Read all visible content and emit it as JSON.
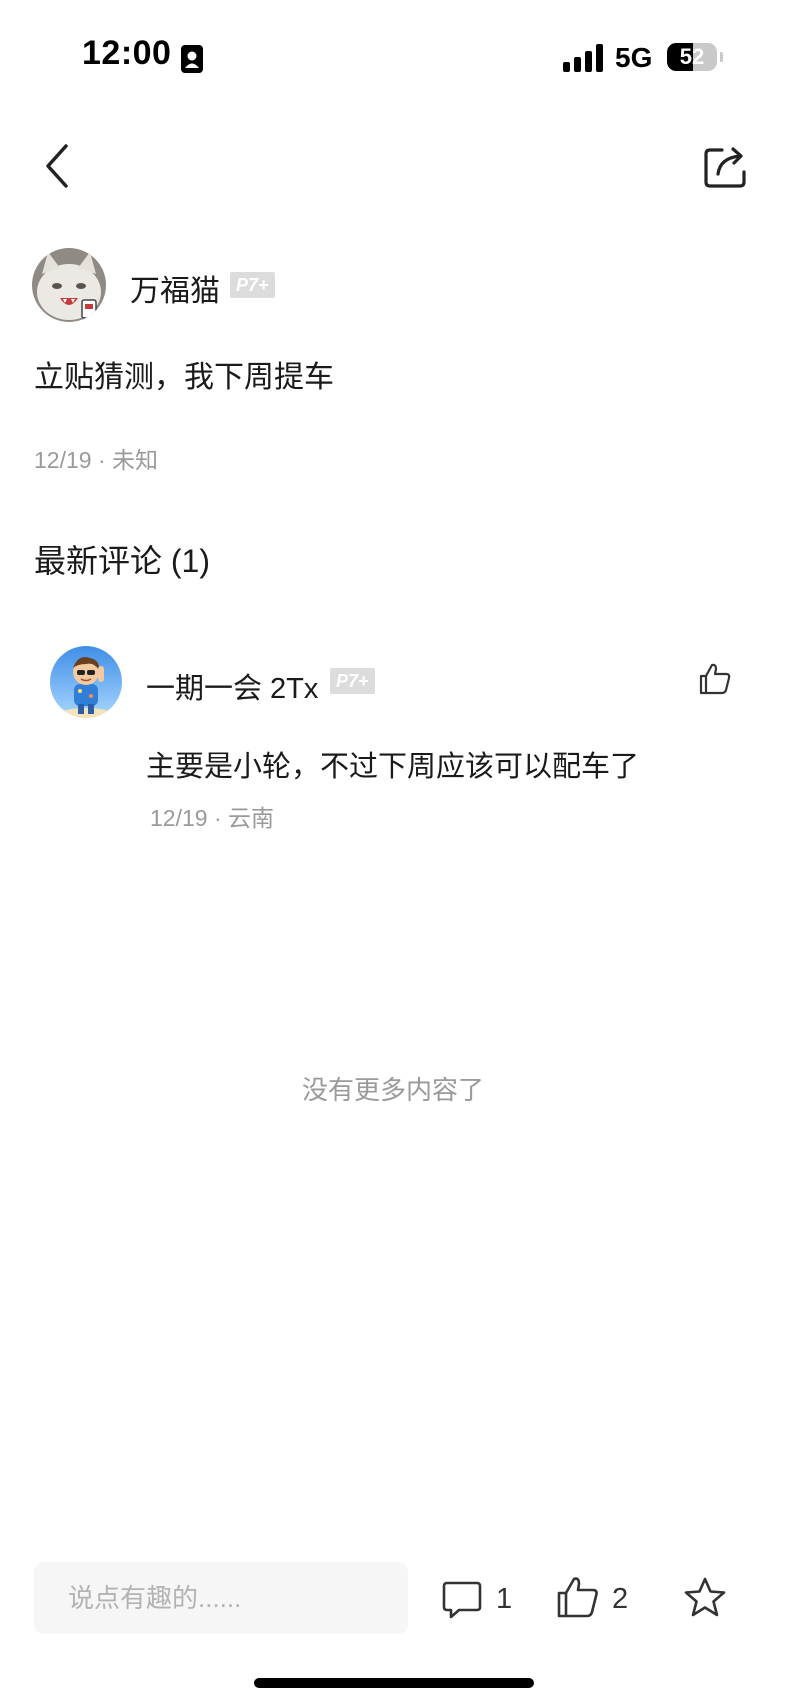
{
  "status_bar": {
    "time": "12:00",
    "network": "5G",
    "battery_level": "52",
    "battery_percent": 52,
    "signal_icon": "cellular-signal-icon",
    "id_icon": "contact-card-icon"
  },
  "nav": {
    "back_icon": "chevron-left-icon",
    "share_icon": "share-icon"
  },
  "post": {
    "author": {
      "name": "万福猫",
      "level": "P7+",
      "avatar_icon": "cat-avatar"
    },
    "content": "立贴猜测，我下周提车",
    "meta": "12/19 · 未知"
  },
  "comments": {
    "title": "最新评论 (1)",
    "items": [
      {
        "author": "一期一会 2Tx",
        "level": "P7+",
        "avatar_icon": "cartoon-boy-avatar",
        "text": "主要是小轮，不过下周应该可以配车了",
        "meta": "12/19 · 云南",
        "like_icon": "thumbs-up-icon"
      }
    ],
    "no_more": "没有更多内容了"
  },
  "bottom_bar": {
    "input_placeholder": "说点有趣的......",
    "comment_count": "1",
    "like_count": "2",
    "comment_icon": "comment-bubble-icon",
    "like_icon": "thumbs-up-icon",
    "favorite_icon": "star-icon"
  },
  "colors": {
    "text_primary": "#1a1a1a",
    "text_secondary": "#9a9a9a",
    "badge_bg": "#dcdcdc",
    "input_bg": "#f6f6f6"
  }
}
